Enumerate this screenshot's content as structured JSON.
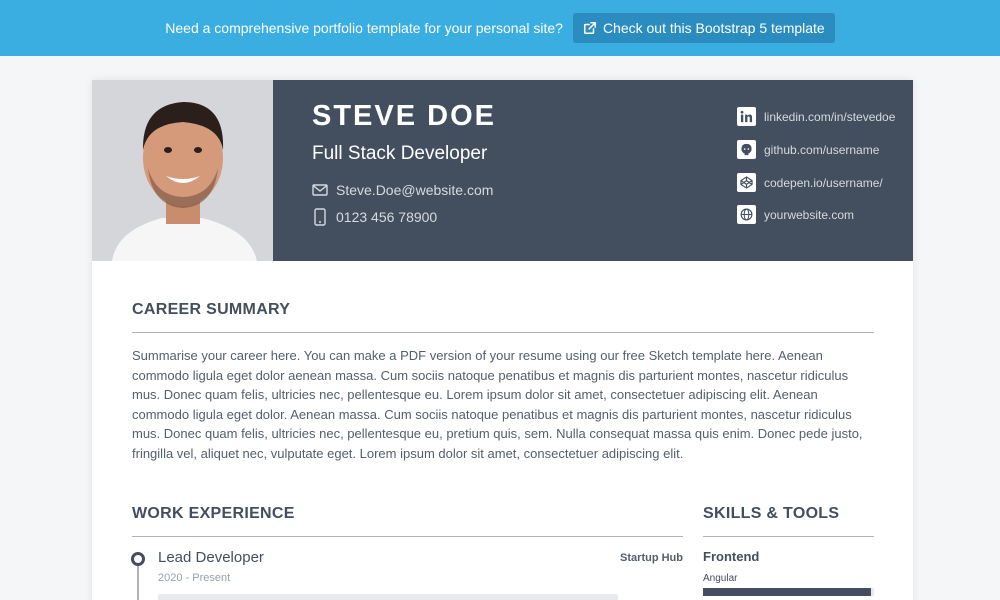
{
  "promo": {
    "text": "Need a comprehensive portfolio template for your personal site?",
    "button_label": "Check out this Bootstrap 5 template"
  },
  "profile": {
    "name": "STEVE DOE",
    "title": "Full Stack Developer",
    "email": "Steve.Doe@website.com",
    "phone": "0123 456 78900"
  },
  "social": [
    {
      "icon": "linkedin-icon",
      "label": "linkedin.com/in/stevedoe"
    },
    {
      "icon": "github-icon",
      "label": "github.com/username"
    },
    {
      "icon": "codepen-icon",
      "label": "codepen.io/username/"
    },
    {
      "icon": "globe-icon",
      "label": "yourwebsite.com"
    }
  ],
  "summary": {
    "heading": "CAREER SUMMARY",
    "text": "Summarise your career here. You can make a PDF version of your resume using our free Sketch template here. Aenean commodo ligula eget dolor aenean massa. Cum sociis natoque penatibus et magnis dis parturient montes, nascetur ridiculus mus. Donec quam felis, ultricies nec, pellentesque eu. Lorem ipsum dolor sit amet, consectetuer adipiscing elit. Aenean commodo ligula eget dolor. Aenean massa. Cum sociis natoque penatibus et magnis dis parturient montes, nascetur ridiculus mus. Donec quam felis, ultricies nec, pellentesque eu, pretium quis, sem. Nulla consequat massa quis enim. Donec pede justo, fringilla vel, aliquet nec, vulputate eget. Lorem ipsum dolor sit amet, consectetuer adipiscing elit."
  },
  "experience": {
    "heading": "WORK EXPERIENCE",
    "job": {
      "title": "Lead Developer",
      "company": "Startup Hub",
      "dates": "2020 - Present"
    }
  },
  "skills": {
    "heading": "SKILLS & TOOLS",
    "group": "Frontend",
    "item": {
      "name": "Angular",
      "level": 0.98
    }
  },
  "colors": {
    "promo_bar": "#3aaee0",
    "header_bg": "#434e5e",
    "accent": "#434e5e"
  }
}
